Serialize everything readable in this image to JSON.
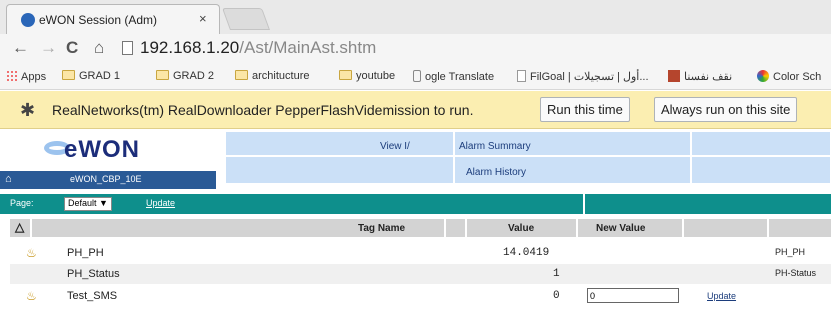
{
  "browser": {
    "tab_title": "eWON Session (Adm)",
    "tab_close": "×",
    "url_host": "192.168.1.20",
    "url_path": "/Ast/MainAst.shtm"
  },
  "bookmarks": [
    {
      "label": "Apps",
      "icon": "apps-icon"
    },
    {
      "label": "GRAD 1",
      "icon": "folder-icon"
    },
    {
      "label": "GRAD 2",
      "icon": "folder-icon"
    },
    {
      "label": "architucture",
      "icon": "folder-icon"
    },
    {
      "label": "youtube",
      "icon": "folder-icon"
    },
    {
      "label": "ogle Translate",
      "icon": "google-icon"
    },
    {
      "label": "FilGoal | أول | تسجيلات...",
      "icon": "page-icon"
    },
    {
      "label": "نقف نفسنا",
      "icon": "image-icon"
    },
    {
      "label": "Color Sch",
      "icon": "color-icon"
    }
  ],
  "infobar": {
    "message": "RealNetworks(tm) RealDownloader PepperFlashVidemission to run.",
    "run_button": "Run this time",
    "always_button": "Always run on this site"
  },
  "ewon": {
    "logo": "eWON",
    "device_name": "eWON_CBP_10E",
    "menu": {
      "view_io": "View I/",
      "alarm_summary": "Alarm Summary",
      "alarm_history": "Alarm History"
    },
    "page_label": "Page:",
    "page_select": "Default",
    "page_update": "Update",
    "table": {
      "headers": {
        "tag_name": "Tag Name",
        "value": "Value",
        "new_value": "New Value"
      },
      "rows": [
        {
          "name": "PH_PH",
          "value": "14.0419",
          "alias": "PH_PH",
          "alarm": true
        },
        {
          "name": "PH_Status",
          "value": "1",
          "alias": "PH-Status",
          "alarm": false
        },
        {
          "name": "Test_SMS",
          "value": "0",
          "new_value": "0",
          "update": "Update",
          "alarm": true
        }
      ]
    }
  }
}
